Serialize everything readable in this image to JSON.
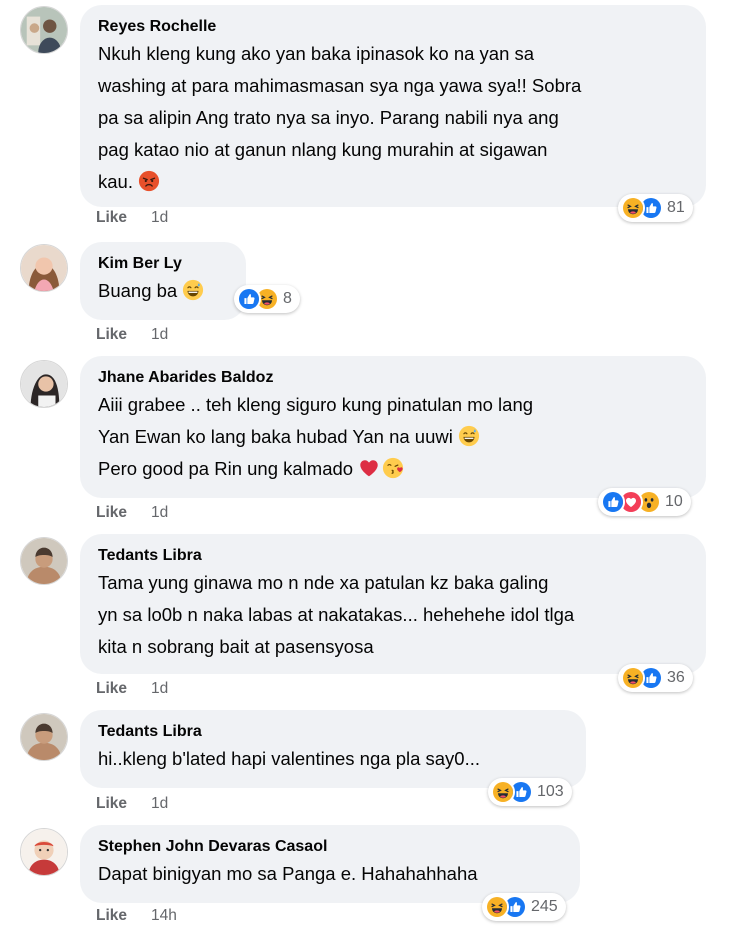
{
  "comments": [
    {
      "author": "Reyes Rochelle",
      "lines": [
        "Nkuh kleng kung ako yan baka ipinasok ko na yan sa",
        "washing at para mahimasmasan sya nga yawa sya!! Sobra",
        "pa sa alipin Ang trato nya sa inyo. Parang nabili nya ang",
        "pag katao nio at ganun nlang kung murahin at sigawan",
        "kau."
      ],
      "reaction_count": "81",
      "like_label": "Like",
      "time": "1d"
    },
    {
      "author": "Kim Ber Ly",
      "lines": [
        "Buang ba"
      ],
      "reaction_count": "8",
      "like_label": "Like",
      "time": "1d"
    },
    {
      "author": "Jhane Abarides Baldoz",
      "lines": [
        "Aiii grabee .. teh kleng siguro kung pinatulan mo lang",
        "Yan Ewan ko lang baka hubad Yan na uuwi",
        "Pero good pa Rin ung kalmado"
      ],
      "reaction_count": "10",
      "like_label": "Like",
      "time": "1d"
    },
    {
      "author": "Tedants Libra",
      "lines": [
        "Tama yung ginawa mo n nde xa patulan kz baka galing",
        "yn sa lo0b n naka labas at nakatakas... hehehehe idol tlga",
        "kita n sobrang bait at pasensyosa"
      ],
      "reaction_count": "36",
      "like_label": "Like",
      "time": "1d"
    },
    {
      "author": "Tedants Libra",
      "lines": [
        "hi..kleng b'lated hapi valentines nga pla say0..."
      ],
      "reaction_count": "103",
      "like_label": "Like",
      "time": "1d"
    },
    {
      "author": "Stephen John Devaras Casaol",
      "lines": [
        "Dapat binigyan mo sa Panga e. Hahahahhaha"
      ],
      "reaction_count": "245",
      "like_label": "Like",
      "time": "14h"
    }
  ],
  "icons": {
    "haha": "haha-reaction-icon",
    "like": "like-reaction-icon",
    "love": "love-reaction-icon",
    "wow": "wow-reaction-icon",
    "angry_emoji": "angry-face-emoji-icon",
    "laugh_emoji": "grinning-sweat-emoji-icon",
    "heart_emoji": "red-heart-emoji-icon",
    "kiss_emoji": "face-blowing-kiss-emoji-icon"
  },
  "colors": {
    "bubble": "#f0f2f5",
    "like_blue": "#1877f2",
    "love_red": "#f33e58",
    "haha_yellow": "#f7b125",
    "meta_grey": "#65676b"
  }
}
